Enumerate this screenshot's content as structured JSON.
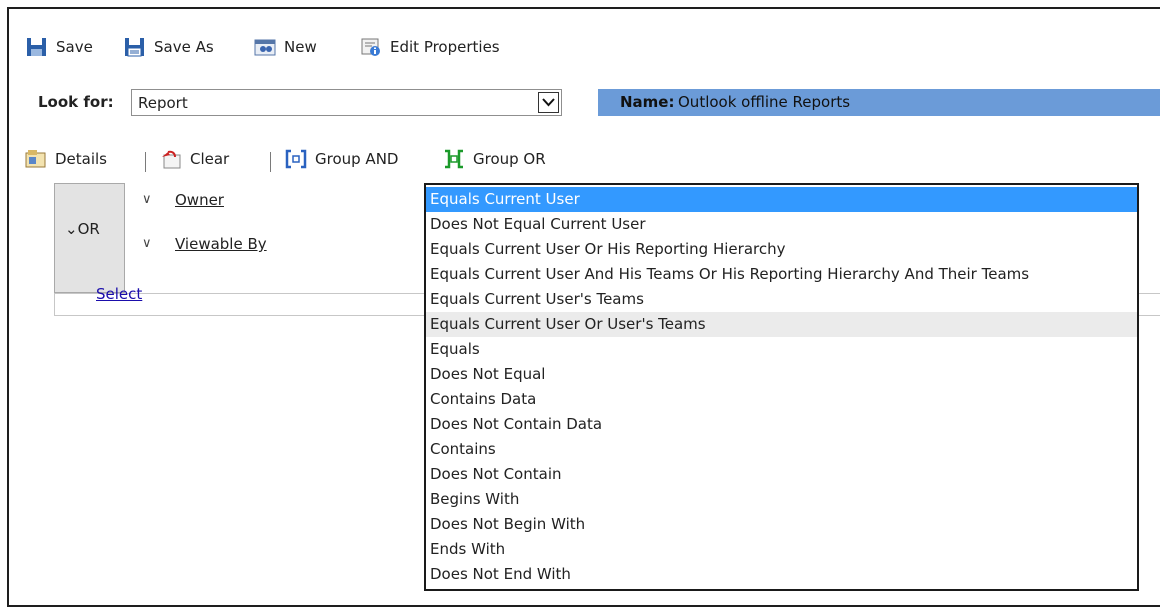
{
  "toolbar": {
    "save_label": "Save",
    "save_as_label": "Save As",
    "new_label": "New",
    "edit_properties_label": "Edit Properties"
  },
  "lookfor": {
    "label": "Look for:",
    "value": "Report"
  },
  "name": {
    "label": "Name:",
    "value": "Outlook offline Reports"
  },
  "filter_toolbar": {
    "details_label": "Details",
    "clear_label": "Clear",
    "group_and_label": "Group AND",
    "group_or_label": "Group OR"
  },
  "group": {
    "operator": "OR",
    "fields": [
      "Owner",
      "Viewable By"
    ],
    "select_link": "Select"
  },
  "dropdown": {
    "selected": "Equals Current User",
    "options": [
      "Equals Current User",
      "Does Not Equal Current User",
      "Equals Current User Or His Reporting Hierarchy",
      "Equals Current User And His Teams Or His Reporting Hierarchy And Their Teams",
      "Equals Current User's Teams",
      "Equals Current User Or User's Teams",
      "Equals",
      "Does Not Equal",
      "Contains Data",
      "Does Not Contain Data",
      "Contains",
      "Does Not Contain",
      "Begins With",
      "Does Not Begin With",
      "Ends With",
      "Does Not End With"
    ]
  }
}
